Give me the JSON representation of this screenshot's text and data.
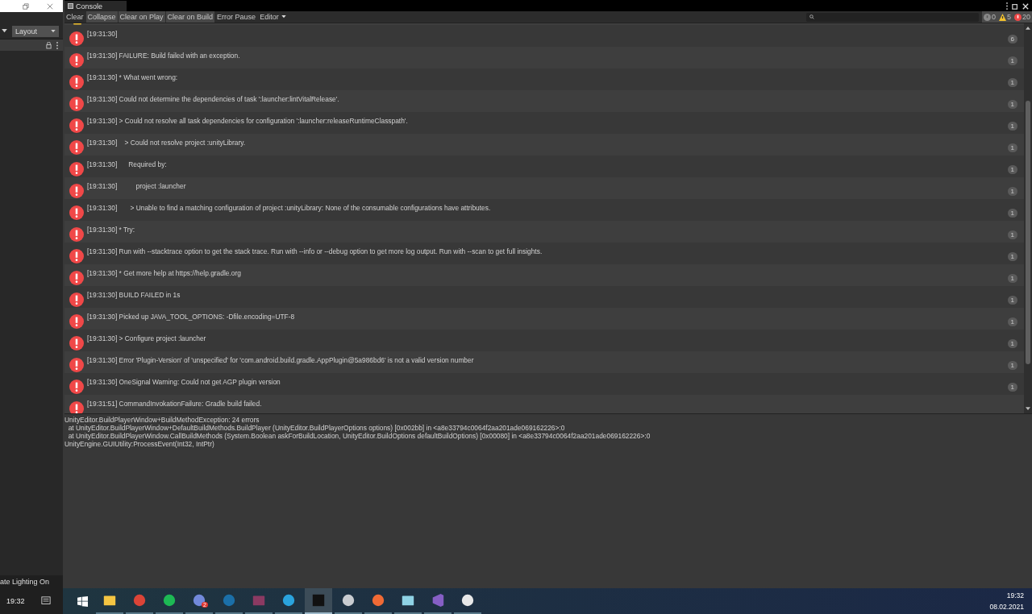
{
  "side_panel": {
    "layout_dropdown": "Layout",
    "status_text": "ate Lighting On",
    "time": "19:32"
  },
  "console": {
    "tab": "Console",
    "toolbar": [
      {
        "label": "Clear",
        "on": false,
        "dropdown": false
      },
      {
        "label": "Collapse",
        "on": true,
        "dropdown": false
      },
      {
        "label": "Clear on Play",
        "on": true,
        "dropdown": false
      },
      {
        "label": "Clear on Build",
        "on": true,
        "dropdown": false
      },
      {
        "label": "Error Pause",
        "on": false,
        "dropdown": false
      },
      {
        "label": "Editor",
        "on": false,
        "dropdown": true
      }
    ],
    "counters": [
      {
        "kind": "info",
        "count": "0",
        "on": true
      },
      {
        "kind": "warning",
        "count": "5",
        "on": true
      },
      {
        "kind": "error",
        "count": "20",
        "on": true
      }
    ],
    "entries": [
      {
        "kind": "error",
        "text": "[19:31:30]",
        "count": "6"
      },
      {
        "kind": "error",
        "text": "[19:31:30] FAILURE: Build failed with an exception.",
        "count": "1"
      },
      {
        "kind": "error",
        "text": "[19:31:30] * What went wrong:",
        "count": "1"
      },
      {
        "kind": "error",
        "text": "[19:31:30] Could not determine the dependencies of task ':launcher:lintVitalRelease'.",
        "count": "1"
      },
      {
        "kind": "error",
        "text": "[19:31:30] > Could not resolve all task dependencies for configuration ':launcher:releaseRuntimeClasspath'.",
        "count": "1"
      },
      {
        "kind": "error",
        "text": "[19:31:30]    > Could not resolve project :unityLibrary.",
        "count": "1"
      },
      {
        "kind": "error",
        "text": "[19:31:30]      Required by:",
        "count": "1"
      },
      {
        "kind": "error",
        "text": "[19:31:30]          project :launcher",
        "count": "1"
      },
      {
        "kind": "error",
        "text": "[19:31:30]       > Unable to find a matching configuration of project :unityLibrary: None of the consumable configurations have attributes.",
        "count": "1"
      },
      {
        "kind": "error",
        "text": "[19:31:30] * Try:",
        "count": "1"
      },
      {
        "kind": "error",
        "text": "[19:31:30] Run with --stacktrace option to get the stack trace. Run with --info or --debug option to get more log output. Run with --scan to get full insights.",
        "count": "1"
      },
      {
        "kind": "error",
        "text": "[19:31:30] * Get more help at https://help.gradle.org",
        "count": "1"
      },
      {
        "kind": "error",
        "text": "[19:31:30] BUILD FAILED in 1s",
        "count": "1"
      },
      {
        "kind": "error",
        "text": "[19:31:30] Picked up JAVA_TOOL_OPTIONS: -Dfile.encoding=UTF-8",
        "count": "1"
      },
      {
        "kind": "error",
        "text": "[19:31:30] > Configure project :launcher",
        "count": "1"
      },
      {
        "kind": "error",
        "text": "[19:31:30] Error 'Plugin-Version' of 'unspecified' for 'com.android.build.gradle.AppPlugin@5a986bd6' is not a valid version number",
        "count": "1"
      },
      {
        "kind": "error",
        "text": "[19:31:30] OneSignal Warning: Could not get AGP plugin version",
        "count": "1"
      },
      {
        "kind": "error",
        "text": "[19:31:51] CommandInvokationFailure: Gradle build failed."
      }
    ],
    "detail": [
      "UnityEditor.BuildPlayerWindow+BuildMethodException: 24 errors",
      "  at UnityEditor.BuildPlayerWindow+DefaultBuildMethods.BuildPlayer (UnityEditor.BuildPlayerOptions options) [0x002bb] in <a8e33794c0064f2aa201ade069162226>:0",
      "  at UnityEditor.BuildPlayerWindow.CallBuildMethods (System.Boolean askForBuildLocation, UnityEditor.BuildOptions defaultBuildOptions) [0x00080] in <a8e33794c0064f2aa201ade069162226>:0",
      "UnityEngine.GUIUtility:ProcessEvent(Int32, IntPtr)"
    ]
  },
  "taskbar": {
    "apps": [
      {
        "kind": "folder",
        "active": false
      },
      {
        "kind": "chrome",
        "active": false
      },
      {
        "kind": "spotify",
        "active": false
      },
      {
        "kind": "chat",
        "active": false,
        "badge": "2"
      },
      {
        "kind": "steam",
        "active": false
      },
      {
        "kind": "archive",
        "active": false
      },
      {
        "kind": "telegram",
        "active": false
      },
      {
        "kind": "unity",
        "active": true
      },
      {
        "kind": "shield",
        "active": false
      },
      {
        "kind": "check",
        "active": false
      },
      {
        "kind": "notes",
        "active": false
      },
      {
        "kind": "vs",
        "active": false
      },
      {
        "kind": "pulse",
        "active": false
      }
    ],
    "time": "19:32",
    "date": "08.02.2021"
  }
}
